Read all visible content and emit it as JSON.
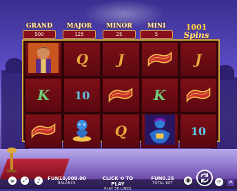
{
  "jackpots": [
    {
      "name": "GRAND",
      "value": "500"
    },
    {
      "name": "MAJOR",
      "value": "125"
    },
    {
      "name": "MINOR",
      "value": "25"
    },
    {
      "name": "MINI",
      "value": "5"
    }
  ],
  "logo": {
    "line1": "1001",
    "line2": "Spins"
  },
  "reels": [
    [
      "aladdin",
      "K",
      "magic-carpet"
    ],
    [
      "Q",
      "10",
      "blue-genie"
    ],
    [
      "J",
      "magic-carpet",
      "Q"
    ],
    [
      "magic-carpet",
      "K",
      "sultan-genie-wild"
    ],
    [
      "J",
      "magic-carpet",
      "10"
    ]
  ],
  "footer": {
    "balance_value": "FUN10,000.00",
    "balance_label": "BALANCE",
    "play_label_pre": "CLICK",
    "play_label_post": "TO PLAY",
    "play_lines": "PLAY 50 LINES",
    "bet_value": "FUN0.25",
    "bet_label": "TOTAL BET"
  },
  "colors": {
    "frame": "#d9a53a",
    "cell": "#7e0f17",
    "jackpot_box": "#8a0f1c"
  }
}
